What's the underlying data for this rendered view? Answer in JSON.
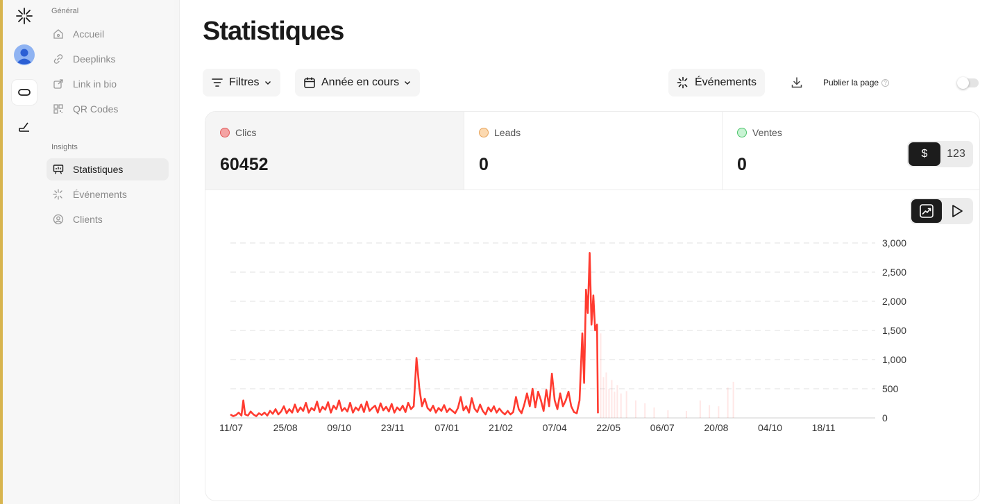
{
  "rail": {
    "items": [
      {
        "icon": "sparkle-logo-icon"
      },
      {
        "icon": "avatar"
      },
      {
        "icon": "link-icon"
      },
      {
        "icon": "chart-up-icon"
      }
    ]
  },
  "sidebar": {
    "general_title": "Général",
    "general_items": [
      {
        "label": "Accueil",
        "icon": "home-icon"
      },
      {
        "label": "Deeplinks",
        "icon": "link-icon"
      },
      {
        "label": "Link in bio",
        "icon": "external-link-icon"
      },
      {
        "label": "QR Codes",
        "icon": "qr-code-icon"
      }
    ],
    "insights_title": "Insights",
    "insights_items": [
      {
        "label": "Statistiques",
        "icon": "presentation-chart-icon",
        "active": true
      },
      {
        "label": "Événements",
        "icon": "sparkle-icon"
      },
      {
        "label": "Clients",
        "icon": "user-circle-icon"
      }
    ]
  },
  "page": {
    "title": "Statistiques"
  },
  "toolbar": {
    "filters_label": "Filtres",
    "period_label": "Année en cours",
    "events_label": "Événements",
    "publish_label": "Publier la page",
    "publish_help": "?",
    "publish_enabled": false
  },
  "metrics": [
    {
      "label": "Clics",
      "value": "60452",
      "dot_color": "#f4a3a3",
      "dot_border": "#e05a5a",
      "active": true
    },
    {
      "label": "Leads",
      "value": "0",
      "dot_color": "#fcd9b0",
      "dot_border": "#e7a35a",
      "active": false
    },
    {
      "label": "Ventes",
      "value": "0",
      "dot_color": "#c8f3d3",
      "dot_border": "#4cc46b",
      "active": false
    }
  ],
  "unit_toggle": {
    "options": [
      "$",
      "123"
    ],
    "selected": "$"
  },
  "view_toggle": {
    "options": [
      "chart-up-icon",
      "play-icon"
    ],
    "selected": "chart-up-icon"
  },
  "chart_data": {
    "type": "line",
    "series": [
      {
        "values_note": "",
        "color": "#ff3b30"
      }
    ],
    "x_tick_labels": [
      "11/07",
      "25/08",
      "09/10",
      "23/11",
      "07/01",
      "21/02",
      "07/04",
      "22/05",
      "06/07",
      "20/08",
      "04/10",
      "18/11"
    ],
    "y_tick_labels": [
      "0",
      "500",
      "1,000",
      "1,500",
      "2,000",
      "2,500",
      "3,000"
    ],
    "ylim": [
      0,
      3000
    ],
    "points": [
      [
        0,
        60
      ],
      [
        3,
        30
      ],
      [
        6,
        50
      ],
      [
        9,
        90
      ],
      [
        12,
        40
      ],
      [
        14,
        300
      ],
      [
        16,
        60
      ],
      [
        19,
        40
      ],
      [
        22,
        110
      ],
      [
        25,
        60
      ],
      [
        28,
        30
      ],
      [
        31,
        80
      ],
      [
        34,
        50
      ],
      [
        37,
        90
      ],
      [
        40,
        40
      ],
      [
        43,
        120
      ],
      [
        46,
        70
      ],
      [
        49,
        150
      ],
      [
        52,
        60
      ],
      [
        55,
        110
      ],
      [
        58,
        200
      ],
      [
        61,
        80
      ],
      [
        64,
        150
      ],
      [
        67,
        90
      ],
      [
        70,
        230
      ],
      [
        73,
        100
      ],
      [
        76,
        180
      ],
      [
        79,
        120
      ],
      [
        82,
        260
      ],
      [
        85,
        90
      ],
      [
        88,
        170
      ],
      [
        91,
        130
      ],
      [
        94,
        280
      ],
      [
        97,
        100
      ],
      [
        100,
        190
      ],
      [
        103,
        140
      ],
      [
        106,
        270
      ],
      [
        109,
        90
      ],
      [
        112,
        210
      ],
      [
        115,
        150
      ],
      [
        118,
        300
      ],
      [
        121,
        120
      ],
      [
        124,
        170
      ],
      [
        127,
        110
      ],
      [
        130,
        260
      ],
      [
        133,
        90
      ],
      [
        136,
        180
      ],
      [
        139,
        130
      ],
      [
        142,
        230
      ],
      [
        145,
        100
      ],
      [
        148,
        280
      ],
      [
        151,
        120
      ],
      [
        154,
        170
      ],
      [
        157,
        210
      ],
      [
        160,
        90
      ],
      [
        163,
        250
      ],
      [
        166,
        130
      ],
      [
        169,
        190
      ],
      [
        172,
        110
      ],
      [
        175,
        240
      ],
      [
        178,
        90
      ],
      [
        181,
        180
      ],
      [
        184,
        130
      ],
      [
        187,
        210
      ],
      [
        190,
        100
      ],
      [
        193,
        260
      ],
      [
        196,
        150
      ],
      [
        199,
        200
      ],
      [
        202,
        1030
      ],
      [
        205,
        520
      ],
      [
        208,
        200
      ],
      [
        211,
        330
      ],
      [
        214,
        170
      ],
      [
        217,
        120
      ],
      [
        220,
        210
      ],
      [
        223,
        90
      ],
      [
        226,
        170
      ],
      [
        229,
        120
      ],
      [
        232,
        220
      ],
      [
        235,
        100
      ],
      [
        238,
        160
      ],
      [
        241,
        120
      ],
      [
        244,
        80
      ],
      [
        247,
        170
      ],
      [
        250,
        360
      ],
      [
        253,
        130
      ],
      [
        256,
        200
      ],
      [
        259,
        90
      ],
      [
        262,
        340
      ],
      [
        265,
        160
      ],
      [
        268,
        100
      ],
      [
        271,
        230
      ],
      [
        274,
        120
      ],
      [
        277,
        60
      ],
      [
        280,
        180
      ],
      [
        283,
        110
      ],
      [
        286,
        200
      ],
      [
        289,
        90
      ],
      [
        292,
        160
      ],
      [
        295,
        100
      ],
      [
        298,
        60
      ],
      [
        301,
        120
      ],
      [
        304,
        60
      ],
      [
        307,
        100
      ],
      [
        310,
        360
      ],
      [
        313,
        150
      ],
      [
        316,
        80
      ],
      [
        319,
        230
      ],
      [
        322,
        420
      ],
      [
        325,
        200
      ],
      [
        328,
        500
      ],
      [
        331,
        180
      ],
      [
        334,
        450
      ],
      [
        337,
        310
      ],
      [
        340,
        120
      ],
      [
        343,
        480
      ],
      [
        346,
        200
      ],
      [
        349,
        760
      ],
      [
        352,
        300
      ],
      [
        355,
        150
      ],
      [
        358,
        420
      ],
      [
        361,
        200
      ],
      [
        364,
        300
      ],
      [
        367,
        450
      ],
      [
        370,
        200
      ],
      [
        373,
        100
      ],
      [
        376,
        80
      ],
      [
        379,
        300
      ],
      [
        382,
        1450
      ],
      [
        384,
        600
      ],
      [
        386,
        2200
      ],
      [
        388,
        1800
      ],
      [
        390,
        2830
      ],
      [
        392,
        1600
      ],
      [
        394,
        2100
      ],
      [
        396,
        1500
      ],
      [
        398,
        1600
      ],
      [
        399,
        80
      ]
    ],
    "faint_bars": [
      [
        402,
        1450
      ],
      [
        405,
        700
      ],
      [
        408,
        780
      ],
      [
        411,
        500
      ],
      [
        414,
        650
      ],
      [
        417,
        450
      ],
      [
        420,
        560
      ],
      [
        424,
        420
      ],
      [
        430,
        460
      ],
      [
        440,
        300
      ],
      [
        450,
        250
      ],
      [
        460,
        180
      ],
      [
        475,
        130
      ],
      [
        495,
        120
      ],
      [
        510,
        300
      ],
      [
        520,
        220
      ],
      [
        530,
        200
      ],
      [
        540,
        520
      ],
      [
        546,
        620
      ]
    ],
    "x_day_max": 700
  }
}
